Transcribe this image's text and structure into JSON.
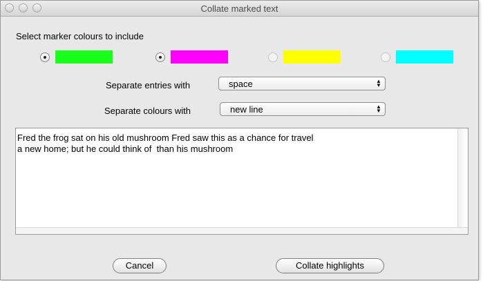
{
  "window": {
    "title": "Collate marked text"
  },
  "section_label": "Select marker colours to include",
  "markers": [
    {
      "color_name": "green",
      "color": "#1aff1a",
      "checked": true
    },
    {
      "color_name": "magenta",
      "color": "#ff00ff",
      "checked": true
    },
    {
      "color_name": "yellow",
      "color": "#ffff00",
      "checked": false
    },
    {
      "color_name": "cyan",
      "color": "#00ffff",
      "checked": false
    }
  ],
  "separate_entries": {
    "label": "Separate entries with",
    "value": "space"
  },
  "separate_colours": {
    "label": "Separate colours with",
    "value": "new line"
  },
  "output_text": "Fred the frog sat on his old mushroom Fred saw this as a chance for travel\na new home; but he could think of  than his mushroom",
  "buttons": {
    "cancel": "Cancel",
    "collate": "Collate highlights"
  },
  "icons": {
    "select_arrows": "up-down-arrows-icon",
    "radio": "radio-button-icon"
  }
}
